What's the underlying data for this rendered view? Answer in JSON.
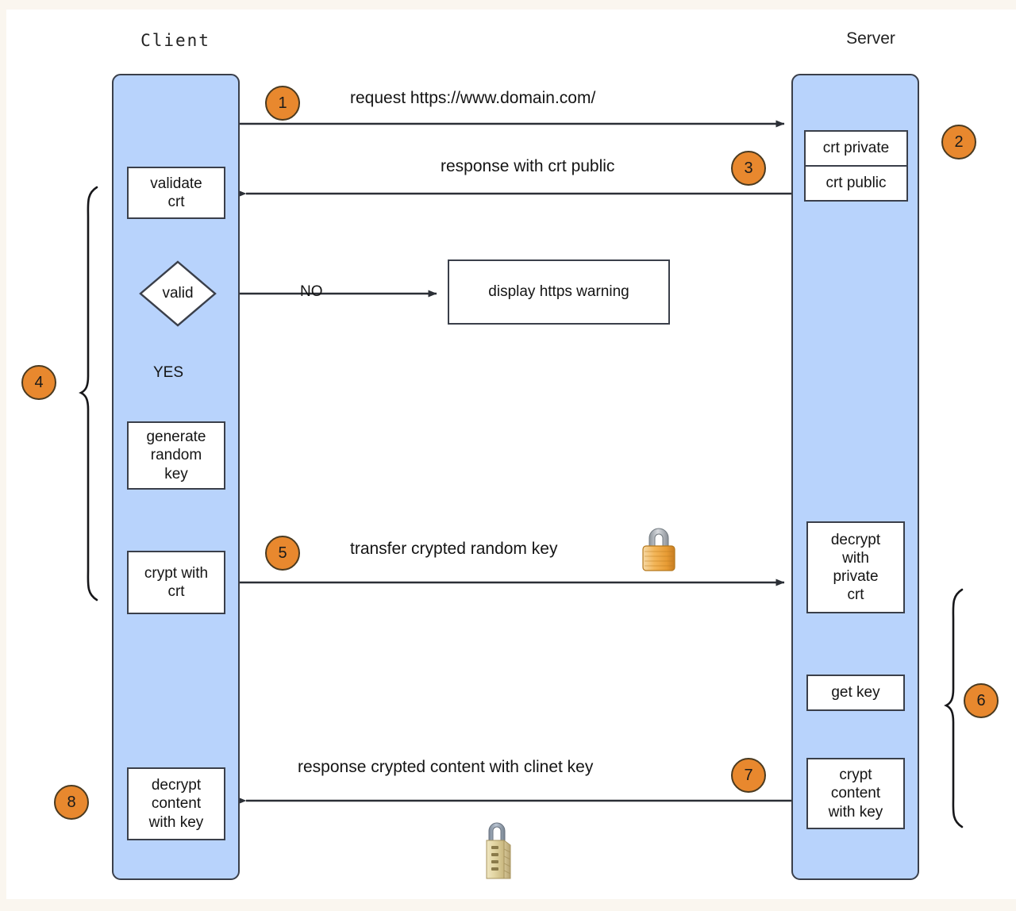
{
  "diagram": {
    "title_client": "Client",
    "title_server": "Server",
    "colors": {
      "lane_fill": "#b8d3fc",
      "lane_stroke": "#3a3f4a",
      "badge_fill": "#e8882e",
      "badge_stroke": "#4a3a20",
      "box_fill": "#ffffff",
      "page_bg": "#faf6ef",
      "canvas_bg": "#ffffff",
      "lock_gold": "#f0b04a",
      "lock_cream": "#e8dcb0",
      "lock_shackle": "#9aa5b1"
    }
  },
  "badges": [
    {
      "id": "1",
      "label": "1"
    },
    {
      "id": "2",
      "label": "2"
    },
    {
      "id": "3",
      "label": "3"
    },
    {
      "id": "4",
      "label": "4"
    },
    {
      "id": "5",
      "label": "5"
    },
    {
      "id": "6",
      "label": "6"
    },
    {
      "id": "7",
      "label": "7"
    },
    {
      "id": "8",
      "label": "8"
    }
  ],
  "messages": {
    "m1": "request https://www.domain.com/",
    "m3": "response with crt public",
    "m5": "transfer crypted random key",
    "m7": "response crypted content with clinet key"
  },
  "labels": {
    "no": "NO",
    "yes": "YES"
  },
  "client_nodes": {
    "validate_crt": "validate\ncrt",
    "valid_decision": "valid",
    "generate_random_key": "generate\nrandom\nkey",
    "crypt_with_crt": "crypt with\ncrt",
    "decrypt_content_with_key": "decrypt\ncontent\nwith key"
  },
  "server_nodes": {
    "crt_private": "crt private",
    "crt_public": "crt public",
    "decrypt_with_private_crt": "decrypt\nwith\nprivate\ncrt",
    "get_key": "get key",
    "crypt_content_with_key": "crypt\ncontent\nwith key"
  },
  "other_nodes": {
    "display_https_warning": "display https warning"
  },
  "icons": {
    "lock_closed_gold": "closed-padlock-icon",
    "lock_combination": "combination-padlock-icon"
  }
}
